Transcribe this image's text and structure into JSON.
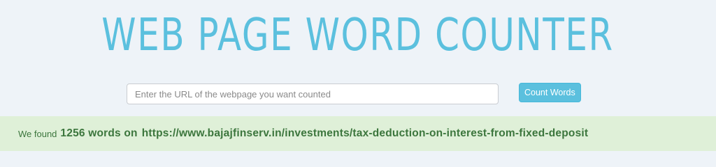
{
  "header": {
    "title": "WEB PAGE WORD COUNTER"
  },
  "search": {
    "placeholder": "Enter the URL of the webpage you want counted",
    "value": "",
    "button_label": "Count Words"
  },
  "result": {
    "prefix": "We found",
    "count_text": "1256 words on",
    "url": "https://www.bajajfinserv.in/investments/tax-deduction-on-interest-from-fixed-deposit"
  },
  "colors": {
    "accent": "#5bc0de",
    "success_bg": "#dff0d8",
    "success_text": "#3c763d",
    "page_bg": "#eef3f8"
  }
}
